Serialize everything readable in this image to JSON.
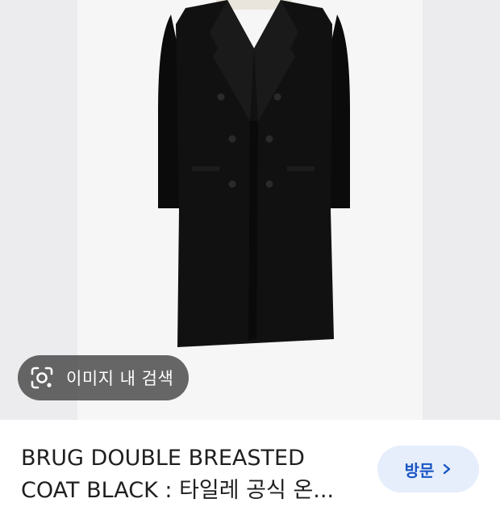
{
  "lens_chip": {
    "label": "이미지 내 검색",
    "icon": "lens-camera-icon"
  },
  "result": {
    "title": "BRUG DOUBLE BREASTED COAT BLACK : 타일레 공식 온..."
  },
  "visit_button": {
    "label": "방문",
    "icon": "chevron-right-icon"
  },
  "colors": {
    "accent": "#1a56c4",
    "button_bg": "#e6eefc",
    "chip_bg": "#464646",
    "image_bg": "#ececef"
  }
}
